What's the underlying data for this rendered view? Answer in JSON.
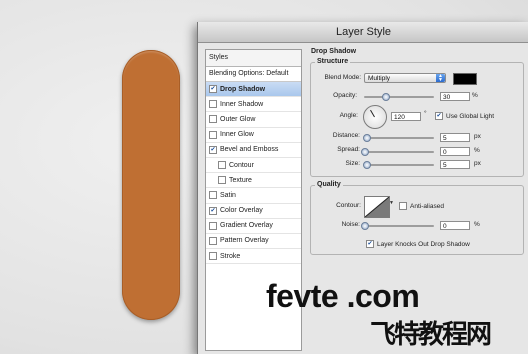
{
  "dialog": {
    "title": "Layer Style"
  },
  "styles_panel": {
    "header": "Styles",
    "blending_label": "Blending Options: Default",
    "items": [
      {
        "label": "Drop Shadow",
        "checked": true,
        "active": true,
        "sub": false
      },
      {
        "label": "Inner Shadow",
        "checked": false,
        "active": false,
        "sub": false
      },
      {
        "label": "Outer Glow",
        "checked": false,
        "active": false,
        "sub": false
      },
      {
        "label": "Inner Glow",
        "checked": false,
        "active": false,
        "sub": false
      },
      {
        "label": "Bevel and Emboss",
        "checked": true,
        "active": false,
        "sub": false
      },
      {
        "label": "Contour",
        "checked": false,
        "active": false,
        "sub": true
      },
      {
        "label": "Texture",
        "checked": false,
        "active": false,
        "sub": true
      },
      {
        "label": "Satin",
        "checked": false,
        "active": false,
        "sub": false
      },
      {
        "label": "Color Overlay",
        "checked": true,
        "active": false,
        "sub": false
      },
      {
        "label": "Gradient Overlay",
        "checked": false,
        "active": false,
        "sub": false
      },
      {
        "label": "Pattern Overlay",
        "checked": false,
        "active": false,
        "sub": false
      },
      {
        "label": "Stroke",
        "checked": false,
        "active": false,
        "sub": false
      }
    ]
  },
  "drop_shadow": {
    "section_title": "Drop Shadow",
    "structure_legend": "Structure",
    "blend_mode_label": "Blend Mode:",
    "blend_mode_value": "Multiply",
    "shadow_color": "#000000",
    "opacity_label": "Opacity:",
    "opacity_value": "30",
    "opacity_unit": "%",
    "angle_label": "Angle:",
    "angle_value": "120",
    "angle_unit": "°",
    "global_light_label": "Use Global Light",
    "global_light_checked": true,
    "distance_label": "Distance:",
    "distance_value": "5",
    "distance_unit": "px",
    "spread_label": "Spread:",
    "spread_value": "0",
    "spread_unit": "%",
    "size_label": "Size:",
    "size_value": "5",
    "size_unit": "px",
    "quality_legend": "Quality",
    "contour_label": "Contour:",
    "anti_aliased_label": "Anti-aliased",
    "anti_aliased_checked": false,
    "noise_label": "Noise:",
    "noise_value": "0",
    "noise_unit": "%",
    "knockout_label": "Layer Knocks Out Drop Shadow",
    "knockout_checked": true
  },
  "watermark": {
    "line1": "fevte .com",
    "line2": "飞特教程网"
  },
  "colors": {
    "pill": "#bf6f33",
    "accent": "#3b7bd8"
  }
}
